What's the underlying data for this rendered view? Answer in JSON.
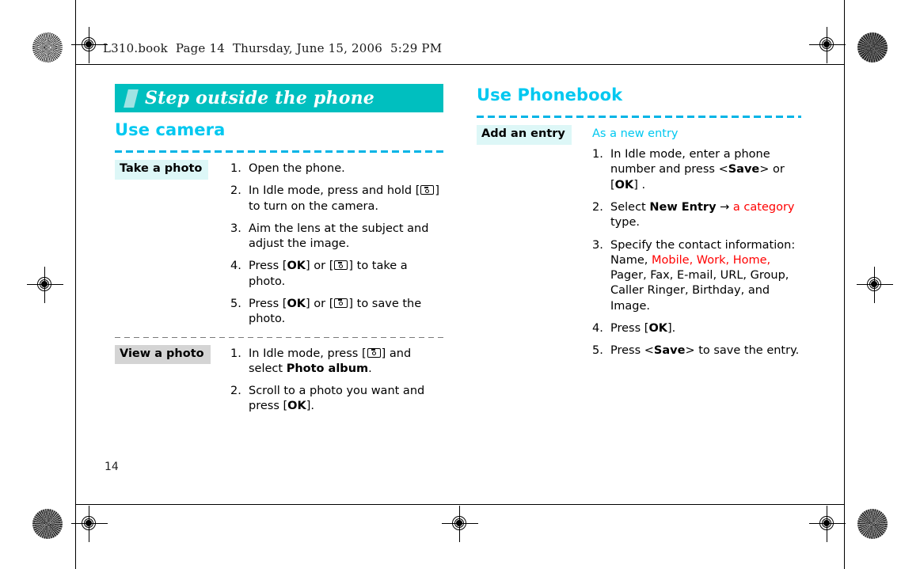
{
  "header": {
    "running_header": "L310.book  Page 14  Thursday, June 15, 2006  5:29 PM"
  },
  "page_number": "14",
  "colors": {
    "banner_bg": "#00bfbf",
    "heading_cyan": "#00c8f0",
    "accent_red": "#ff0000",
    "label_cyan_bg": "#ddf7f7",
    "label_gray_bg": "#d4d4d4"
  },
  "left_column": {
    "banner_title": "Step outside the phone",
    "section_title": "Use camera",
    "rows": [
      {
        "label": "Take a photo",
        "label_style": "cyan",
        "steps": [
          {
            "num": "1.",
            "parts": [
              {
                "t": "Open the phone."
              }
            ]
          },
          {
            "num": "2.",
            "parts": [
              {
                "t": "In Idle mode, press and hold ["
              },
              {
                "icon": "camera-key-icon"
              },
              {
                "t": "] to turn on the camera."
              }
            ]
          },
          {
            "num": "3.",
            "parts": [
              {
                "t": "Aim the lens at the subject and adjust the image."
              }
            ]
          },
          {
            "num": "4.",
            "parts": [
              {
                "t": "Press ["
              },
              {
                "t": "OK",
                "bold": true
              },
              {
                "t": "] or ["
              },
              {
                "icon": "camera-key-icon"
              },
              {
                "t": "] to take a photo."
              }
            ]
          },
          {
            "num": "5.",
            "parts": [
              {
                "t": "Press ["
              },
              {
                "t": "OK",
                "bold": true
              },
              {
                "t": "] or ["
              },
              {
                "icon": "camera-key-icon"
              },
              {
                "t": "] to save the photo."
              }
            ]
          }
        ]
      },
      {
        "label": "View a photo",
        "label_style": "gray",
        "steps": [
          {
            "num": "1.",
            "parts": [
              {
                "t": "In Idle mode, press ["
              },
              {
                "icon": "camera-key-icon"
              },
              {
                "t": "] and select "
              },
              {
                "t": "Photo album",
                "bold": true
              },
              {
                "t": "."
              }
            ]
          },
          {
            "num": "2.",
            "parts": [
              {
                "t": "Scroll to a photo you want and press ["
              },
              {
                "t": "OK",
                "bold": true
              },
              {
                "t": "]."
              }
            ]
          }
        ]
      }
    ]
  },
  "right_column": {
    "section_title": "Use Phonebook",
    "rows": [
      {
        "label": "Add an entry",
        "label_style": "cyan",
        "sub_head": "As a new entry",
        "steps": [
          {
            "num": "1.",
            "parts": [
              {
                "t": "In Idle mode, enter a phone number and press <"
              },
              {
                "t": "Save",
                "bold": true
              },
              {
                "t": "> or ["
              },
              {
                "t": "OK",
                "bold": true
              },
              {
                "t": "] ."
              }
            ]
          },
          {
            "num": "2.",
            "parts": [
              {
                "t": "Select "
              },
              {
                "t": "New Entry",
                "bold": true
              },
              {
                "t": " → "
              },
              {
                "t": "a category",
                "red": true
              },
              {
                "t": " type."
              }
            ]
          },
          {
            "num": "3.",
            "parts": [
              {
                "t": "Specify the contact information: Name, "
              },
              {
                "t": "Mobile, Work, Home,",
                "red": true
              },
              {
                "t": " Pager, Fax, E-mail, URL, Group, Caller Ringer, Birthday, and Image."
              }
            ]
          },
          {
            "num": "4.",
            "parts": [
              {
                "t": "Press ["
              },
              {
                "t": "OK",
                "bold": true
              },
              {
                "t": "]."
              }
            ]
          },
          {
            "num": "5.",
            "parts": [
              {
                "t": "Press <"
              },
              {
                "t": "Save",
                "bold": true
              },
              {
                "t": "> to save the entry."
              }
            ]
          }
        ]
      }
    ]
  }
}
